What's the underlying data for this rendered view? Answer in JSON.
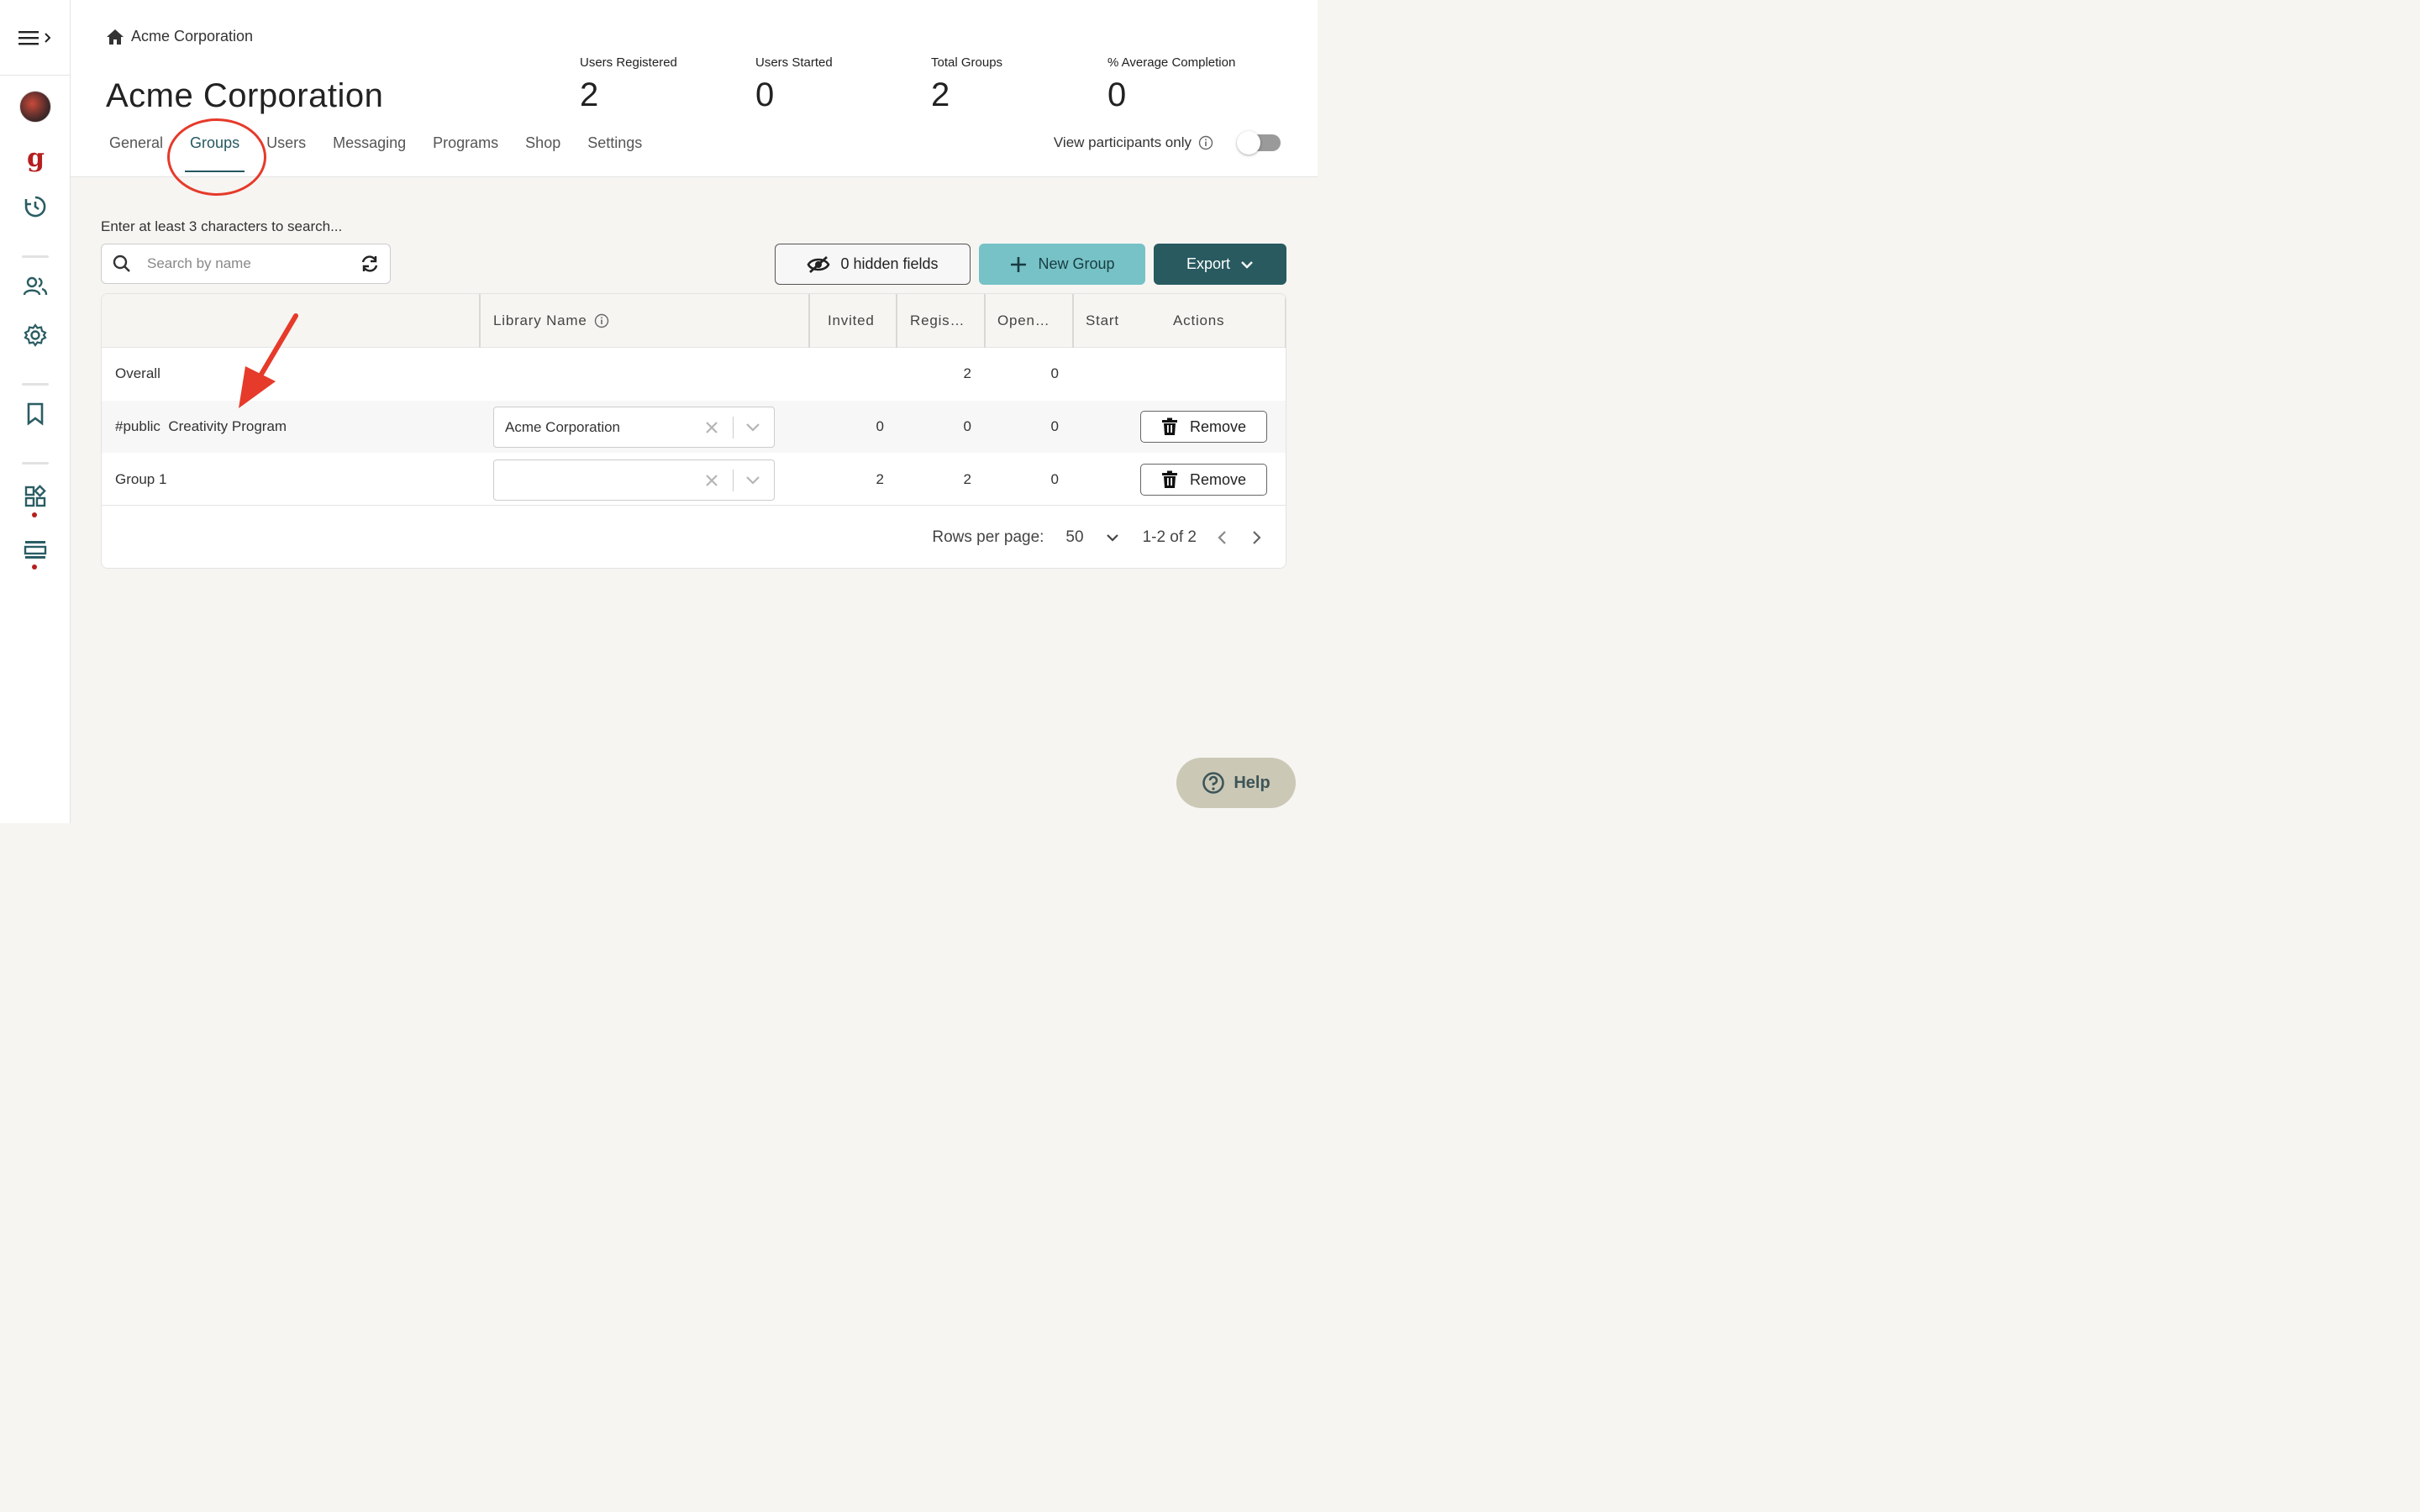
{
  "breadcrumb": {
    "label": "Acme Corporation"
  },
  "page": {
    "title": "Acme Corporation"
  },
  "stats": [
    {
      "label": "Users Registered",
      "value": "2"
    },
    {
      "label": "Users Started",
      "value": "0"
    },
    {
      "label": "Total Groups",
      "value": "2"
    },
    {
      "label": "% Average Completion",
      "value": "0"
    }
  ],
  "tabs": [
    {
      "label": "General"
    },
    {
      "label": "Groups"
    },
    {
      "label": "Users"
    },
    {
      "label": "Messaging"
    },
    {
      "label": "Programs"
    },
    {
      "label": "Shop"
    },
    {
      "label": "Settings"
    }
  ],
  "active_tab": "Groups",
  "view_participants": {
    "label": "View participants only",
    "enabled": false
  },
  "search": {
    "hint": "Enter at least 3 characters to search...",
    "placeholder": "Search by name"
  },
  "toolbar": {
    "hidden_fields_label": "0 hidden fields",
    "new_group_label": "New Group",
    "export_label": "Export"
  },
  "table": {
    "columns": [
      "",
      "Library Name",
      "Invited",
      "Regis…",
      "Open…",
      "Start",
      "Actions"
    ],
    "rows": [
      {
        "name": "Overall",
        "library": null,
        "invited": "",
        "registered": "2",
        "opened": "0",
        "remove": null
      },
      {
        "name": "#public  Creativity Program",
        "library": "Acme Corporation",
        "invited": "0",
        "registered": "0",
        "opened": "0",
        "remove": "Remove"
      },
      {
        "name": "Group 1",
        "library": "",
        "invited": "2",
        "registered": "2",
        "opened": "0",
        "remove": "Remove"
      }
    ]
  },
  "pagination": {
    "rows_per_page_label": "Rows per page:",
    "rows_per_page": "50",
    "range": "1-2 of 2"
  },
  "help": {
    "label": "Help"
  },
  "colors": {
    "accent": "#255860",
    "new_group": "#76c2c6",
    "export": "#285a60",
    "annotation": "#e63a2a",
    "brand_red": "#b51f1f"
  }
}
